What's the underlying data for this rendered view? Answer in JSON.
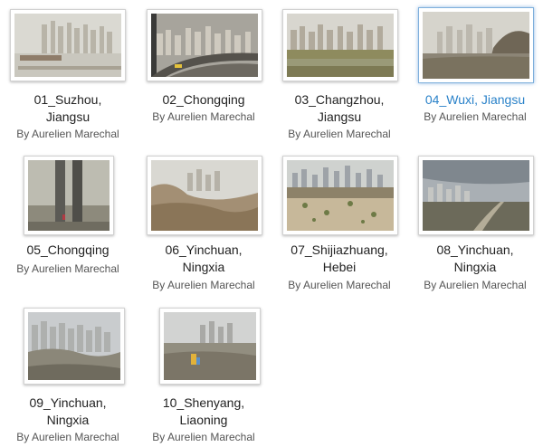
{
  "gallery": {
    "items": [
      {
        "title_line1": "01_Suzhou,",
        "title_line2": "Jiangsu",
        "byline": "By Aurelien Marechal",
        "selected": false
      },
      {
        "title_line1": "02_Chongqing",
        "title_line2": "",
        "byline": "By Aurelien Marechal",
        "selected": false
      },
      {
        "title_line1": "03_Changzhou,",
        "title_line2": "Jiangsu",
        "byline": "By Aurelien Marechal",
        "selected": false
      },
      {
        "title_line1": "04_Wuxi, Jiangsu",
        "title_line2": "",
        "byline": "By Aurelien Marechal",
        "selected": true
      },
      {
        "title_line1": "05_Chongqing",
        "title_line2": "",
        "byline": "By Aurelien Marechal",
        "selected": false
      },
      {
        "title_line1": "06_Yinchuan,",
        "title_line2": "Ningxia",
        "byline": "By Aurelien Marechal",
        "selected": false
      },
      {
        "title_line1": "07_Shijiazhuang,",
        "title_line2": "Hebei",
        "byline": "By Aurelien Marechal",
        "selected": false
      },
      {
        "title_line1": "08_Yinchuan,",
        "title_line2": "Ningxia",
        "byline": "By Aurelien Marechal",
        "selected": false
      },
      {
        "title_line1": "09_Yinchuan,",
        "title_line2": "Ningxia",
        "byline": "By Aurelien Marechal",
        "selected": false
      },
      {
        "title_line1": "10_Shenyang,",
        "title_line2": "Liaoning",
        "byline": "By Aurelien Marechal",
        "selected": false
      }
    ],
    "colors": {
      "selected_title": "#2a82c9",
      "title": "#222222",
      "byline": "#555555"
    }
  }
}
